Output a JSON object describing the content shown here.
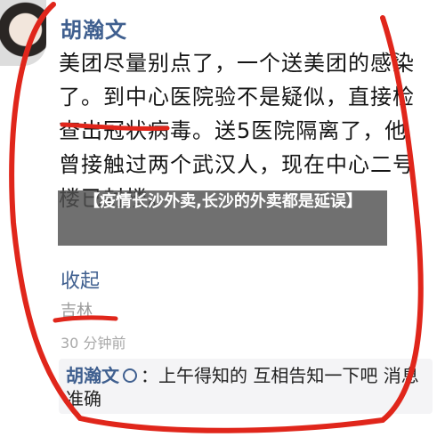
{
  "post": {
    "username": "胡瀚文",
    "body": "美团尽量别点了，一个送美团的感染了。到中心医院验不是疑似，直接检查出冠状病毒。送5医院隔离了，他曾接触过两个武汉人，现在中心二号楼已封楼。",
    "collapse": "收起",
    "location": "吉林",
    "time": "30 分钟前"
  },
  "comment": {
    "author": "胡瀚文",
    "separator": "：",
    "text": "上午得知的 互相告知一下吧 消息准确"
  },
  "overlay": {
    "title": "【疫情长沙外卖,长沙的外卖都是延误】"
  },
  "colors": {
    "link": "#3f5f8f",
    "annotation": "#e0261b",
    "overlay_bg": "#505050"
  }
}
